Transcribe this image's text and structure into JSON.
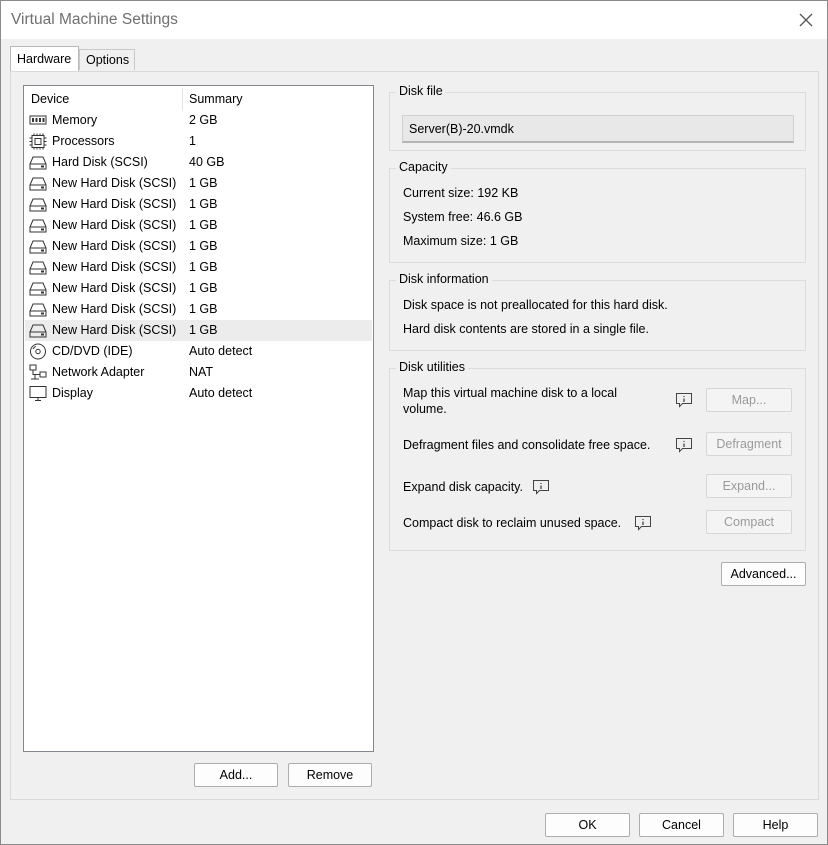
{
  "window": {
    "title": "Virtual Machine Settings"
  },
  "tabs": [
    {
      "label": "Hardware",
      "active": true
    },
    {
      "label": "Options",
      "active": false
    }
  ],
  "device_list": {
    "columns": [
      "Device",
      "Summary"
    ],
    "rows": [
      {
        "icon": "memory-icon",
        "device": "Memory",
        "summary": "2 GB"
      },
      {
        "icon": "processor-icon",
        "device": "Processors",
        "summary": "1"
      },
      {
        "icon": "hard-disk-icon",
        "device": "Hard Disk (SCSI)",
        "summary": "40 GB"
      },
      {
        "icon": "hard-disk-icon",
        "device": "New Hard Disk (SCSI)",
        "summary": "1 GB"
      },
      {
        "icon": "hard-disk-icon",
        "device": "New Hard Disk (SCSI)",
        "summary": "1 GB"
      },
      {
        "icon": "hard-disk-icon",
        "device": "New Hard Disk (SCSI)",
        "summary": "1 GB"
      },
      {
        "icon": "hard-disk-icon",
        "device": "New Hard Disk (SCSI)",
        "summary": "1 GB"
      },
      {
        "icon": "hard-disk-icon",
        "device": "New Hard Disk (SCSI)",
        "summary": "1 GB"
      },
      {
        "icon": "hard-disk-icon",
        "device": "New Hard Disk (SCSI)",
        "summary": "1 GB"
      },
      {
        "icon": "hard-disk-icon",
        "device": "New Hard Disk (SCSI)",
        "summary": "1 GB"
      },
      {
        "icon": "hard-disk-icon",
        "device": "New Hard Disk (SCSI)",
        "summary": "1 GB",
        "selected": true
      },
      {
        "icon": "cd-dvd-icon",
        "device": "CD/DVD (IDE)",
        "summary": "Auto detect"
      },
      {
        "icon": "network-adapter-icon",
        "device": "Network Adapter",
        "summary": "NAT"
      },
      {
        "icon": "display-icon",
        "device": "Display",
        "summary": "Auto detect"
      }
    ],
    "add_label": "Add...",
    "remove_label": "Remove"
  },
  "disk_file": {
    "label": "Disk file",
    "value": "Server(B)-20.vmdk"
  },
  "capacity": {
    "label": "Capacity",
    "current_size": "Current size: 192 KB",
    "system_free": "System free: 46.6 GB",
    "maximum_size": "Maximum size: 1 GB"
  },
  "disk_information": {
    "label": "Disk information",
    "line1": "Disk space is not preallocated for this hard disk.",
    "line2": "Hard disk contents are stored in a single file."
  },
  "disk_utilities": {
    "label": "Disk utilities",
    "map_text_line1": "Map this virtual machine disk to a local",
    "map_text_line2": "volume.",
    "map_button": "Map...",
    "defrag_text": "Defragment files and consolidate free space.",
    "defrag_button": "Defragment",
    "expand_text": "Expand disk capacity.",
    "expand_button": "Expand...",
    "compact_text": "Compact disk to reclaim unused space.",
    "compact_button": "Compact"
  },
  "advanced_button": "Advanced...",
  "footer": {
    "ok": "OK",
    "cancel": "Cancel",
    "help": "Help"
  }
}
